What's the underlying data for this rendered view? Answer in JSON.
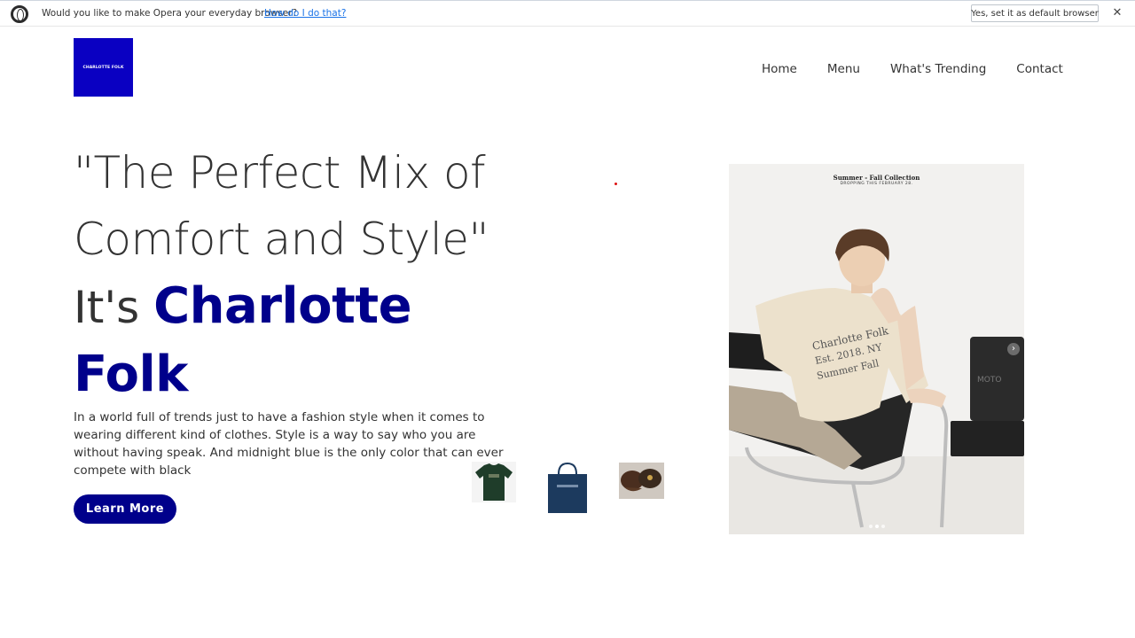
{
  "opera_bar": {
    "message": "Would you like to make Opera your everyday browser?",
    "link": "How do I do that?",
    "default_button": "Yes, set it as default browser",
    "close": "✕"
  },
  "header": {
    "logo_text": "CHARLOTTE FOLK",
    "nav": [
      "Home",
      "Menu",
      "What's Trending",
      "Contact"
    ]
  },
  "hero": {
    "quote_line1": "\"The Perfect Mix of",
    "quote_line2": "Comfort and Style\"",
    "its": "It's",
    "brand_line1": "Charlotte",
    "brand_line2": "Folk",
    "description": "In a world full of trends just to have a fashion style when it comes to wearing different kind of clothes. Style is a way to say who you are without having speak. And midnight blue is the only color that can ever compete with black",
    "button": "Learn More"
  },
  "thumbnails": [
    "green-tshirt",
    "navy-tote-bag",
    "brown-cap"
  ],
  "photo": {
    "title": "Summer - Fall Collection",
    "subtitle": "DROPPING THIS FEBRUARY 28.",
    "shirt_print_line1": "Charlotte Folk",
    "shirt_print_line2": "Est. 2018. NY",
    "shirt_print_line3": "Summer Fall",
    "next_icon": "›"
  },
  "colors": {
    "brand_blue": "#00008b",
    "logo_blue": "#0a00c2"
  }
}
